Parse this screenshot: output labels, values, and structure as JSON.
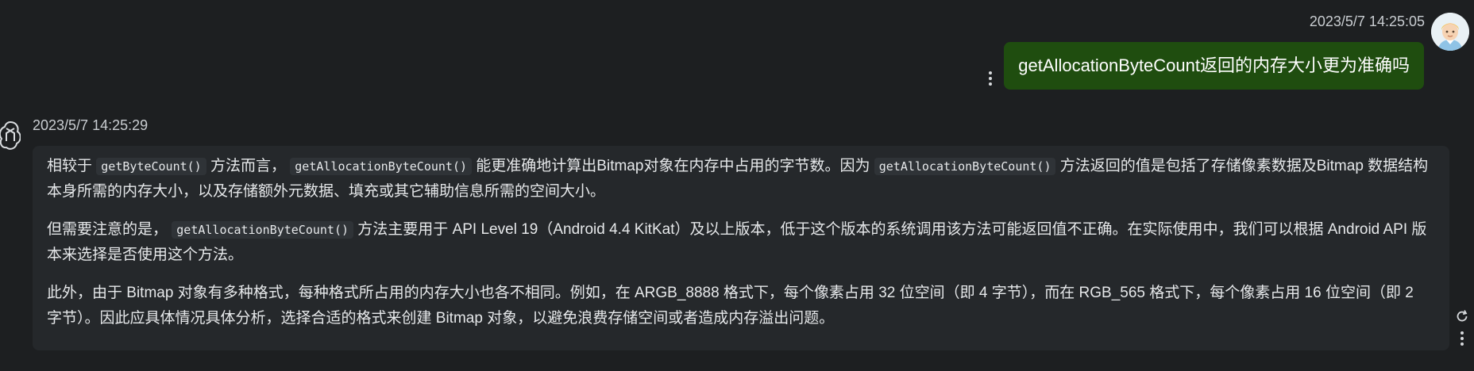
{
  "user_message": {
    "timestamp": "2023/5/7 14:25:05",
    "text": "getAllocationByteCount返回的内存大小更为准确吗",
    "bubble_color": "#1f4d0f",
    "avatar_icon": "user-avatar-icon",
    "menu_icon": "more-vertical-icon"
  },
  "assistant_message": {
    "timestamp": "2023/5/7 14:25:29",
    "avatar_icon": "openai-logo-icon",
    "paragraphs": [
      {
        "parts": [
          {
            "t": "text",
            "v": "相较于 "
          },
          {
            "t": "code",
            "v": "getByteCount()"
          },
          {
            "t": "text",
            "v": " 方法而言， "
          },
          {
            "t": "code",
            "v": "getAllocationByteCount()"
          },
          {
            "t": "text",
            "v": " 能更准确地计算出Bitmap对象在内存中占用的字节数。因为 "
          },
          {
            "t": "code",
            "v": "getAllocationByteCount()"
          },
          {
            "t": "text",
            "v": " 方法返回的值是包括了存储像素数据及Bitmap 数据结构本身所需的内存大小，以及存储额外元数据、填充或其它辅助信息所需的空间大小。"
          }
        ]
      },
      {
        "parts": [
          {
            "t": "text",
            "v": "但需要注意的是， "
          },
          {
            "t": "code",
            "v": "getAllocationByteCount()"
          },
          {
            "t": "text",
            "v": " 方法主要用于 API Level 19（Android 4.4 KitKat）及以上版本，低于这个版本的系统调用该方法可能返回值不正确。在实际使用中，我们可以根据 Android API 版本来选择是否使用这个方法。"
          }
        ]
      },
      {
        "parts": [
          {
            "t": "text",
            "v": "此外，由于 Bitmap 对象有多种格式，每种格式所占用的内存大小也各不相同。例如，在 ARGB_8888 格式下，每个像素占用 32 位空间（即 4 字节），而在 RGB_565 格式下，每个像素占用 16 位空间（即 2 字节）。因此应具体情况具体分析，选择合适的格式来创建 Bitmap 对象，以避免浪费存储空间或者造成内存溢出问题。"
          }
        ]
      }
    ],
    "tools": {
      "refresh_icon": "refresh-icon",
      "menu_icon": "more-vertical-icon"
    }
  },
  "colors": {
    "background": "#1d1f21",
    "assistant_bubble": "#25282b",
    "text": "#e6e8ea",
    "timestamp": "#c9cdd1"
  }
}
